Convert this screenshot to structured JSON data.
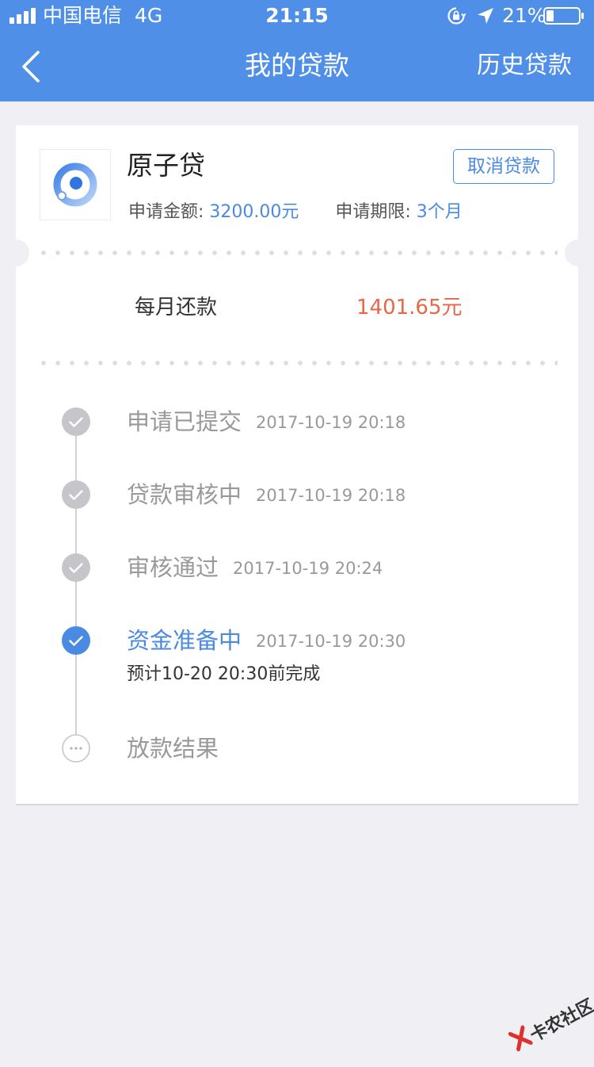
{
  "status_bar": {
    "carrier": "中国电信",
    "network": "4G",
    "time": "21:15",
    "battery": "21%"
  },
  "nav": {
    "title": "我的贷款",
    "history": "历史贷款"
  },
  "loan": {
    "product_name": "原子贷",
    "cancel_label": "取消贷款",
    "amount_label": "申请金额: ",
    "amount_value": "3200.00元",
    "term_label": "申请期限: ",
    "term_value": "3个月",
    "monthly_label": "每月还款",
    "monthly_value": "1401.65元"
  },
  "timeline": [
    {
      "title": "申请已提交",
      "time": "2017-10-19 20:18",
      "status": "done"
    },
    {
      "title": "贷款审核中",
      "time": "2017-10-19 20:18",
      "status": "done"
    },
    {
      "title": "审核通过",
      "time": "2017-10-19 20:24",
      "status": "done"
    },
    {
      "title": "资金准备中",
      "time": "2017-10-19 20:30",
      "status": "active",
      "note": "预计10-20 20:30前完成"
    },
    {
      "title": "放款结果",
      "time": "",
      "status": "pending"
    }
  ],
  "watermark": {
    "text": "卡农社区"
  },
  "colors": {
    "primary": "#4f8fe8",
    "accent_blue": "#4a8ae0",
    "amount_red": "#e8664a",
    "done_gray": "#c6c6ca",
    "background": "#efeff4"
  },
  "icons": {
    "back": "chevron-left-icon",
    "lock": "rotation-lock-icon",
    "location": "location-arrow-icon",
    "battery": "battery-icon",
    "step_done": "check-circle-icon",
    "step_active": "check-circle-icon",
    "step_pending": "ellipsis-circle-icon"
  }
}
